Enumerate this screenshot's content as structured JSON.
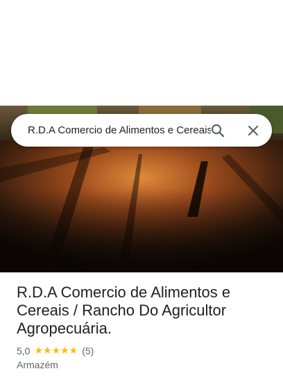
{
  "search": {
    "query": "R.D.A Comercio de Alimentos e Cereais / Rancho Do Agricultor Agropecuária."
  },
  "place": {
    "name": "R.D.A Comercio de Alimentos e Cereais / Rancho Do Agricultor Agropecuária.",
    "rating": "5,0",
    "stars": "★★★★★",
    "review_count": "(5)",
    "category": "Armazém"
  },
  "icons": {
    "search": "search-icon",
    "close": "close-icon"
  },
  "colors": {
    "star": "#fbbc04",
    "text_primary": "#202124",
    "text_secondary": "#5f6368",
    "icon": "#5f6368"
  }
}
